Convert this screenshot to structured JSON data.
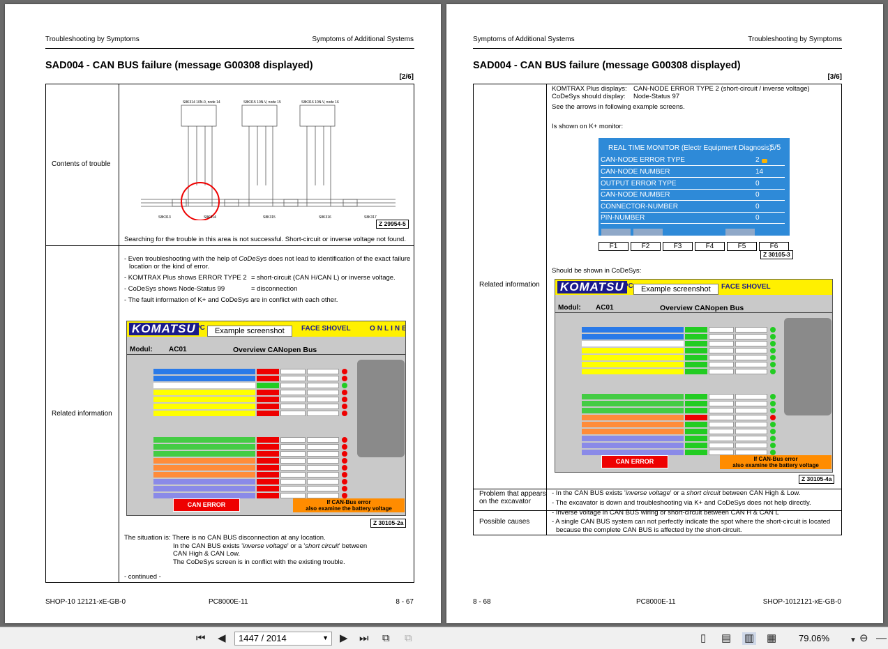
{
  "left_page": {
    "header_left": "Troubleshooting by Symptoms",
    "header_right": "Symptoms of Additional Systems",
    "title": "SAD004 - CAN BUS failure (message G00308 displayed)",
    "page_marker": "[2/6]",
    "contents_label": "Contents of trouble",
    "related_label": "Related information",
    "diagram": {
      "node_labels": [
        "S8K314 10N-0, node 14",
        "S8K315 10N-V, node 15",
        "S8K316 10N-V, node 16"
      ],
      "bottom_labels": [
        "S8K313",
        "S8K314",
        "S8K315",
        "S8K316",
        "S8K317"
      ],
      "zref": "Z 29954-5"
    },
    "search_text": "Searching for the trouble in this area is not successful. Short-circuit or inverse voltage not found.",
    "bullet_1a": "- Even troubleshooting with the help of ",
    "bullet_1_em": "CoDeSys",
    "bullet_1b": " does not lead to identification of the exact failure",
    "bullet_1c": "location or the kind of error.",
    "bullet_2a": "- KOMTRAX Plus shows ERROR TYPE 2",
    "bullet_2b": "= short-circuit (CAN H/CAN L) or inverse voltage.",
    "bullet_3a": "- CoDeSys shows Node-Status 99",
    "bullet_3b": "= disconnection",
    "bullet_4": "- The fault information of K+ and CoDeSys are in conflict with each other.",
    "screenshot": {
      "logo": "KOMATSU",
      "pc": "PC",
      "callout": "Example screenshot",
      "face": "FACE SHOVEL",
      "online": "ONLINE",
      "modul": "Modul:",
      "modul_val": "AC01",
      "overview": "Overview CANopen Bus",
      "can_error": "CAN ERROR",
      "can_bus_1": "If CAN-Bus error",
      "can_bus_2": "also examine the battery voltage",
      "zref": "Z 30105-2a"
    },
    "situation_a": "The situation is: There is no CAN BUS disconnection at any location.",
    "situation_b1": "In the CAN BUS exists '",
    "situation_b_em1": "inverse voltage",
    "situation_b2": "' or a '",
    "situation_b_em2": "short circuit",
    "situation_b3": "' between",
    "situation_c": "CAN High & CAN Low.",
    "situation_d": "The CoDeSys screen is in conflict with the existing trouble.",
    "continued": "- continued -",
    "footer_left": "SHOP-10 12121-xE-GB-0",
    "footer_mid": "PC8000E-11",
    "footer_right": "8  - 67"
  },
  "right_page": {
    "header_left": "Symptoms of Additional Systems",
    "header_right": "Troubleshooting by Symptoms",
    "title": "SAD004 - CAN BUS failure (message G00308 displayed)",
    "page_marker": "[3/6]",
    "related_label": "Related information",
    "komtrax_a": "KOMTRAX Plus displays:",
    "komtrax_b": "CAN-NODE ERROR TYPE 2 (short-circuit / inverse voltage)",
    "codesys_a": "CoDeSys should display:",
    "codesys_b": "Node-Status 97",
    "see_arrows": "See the arrows in following example screens.",
    "shown_kplus": "Is shown on K+ monitor:",
    "monitor": {
      "title": "REAL TIME MONITOR (Electr Equipment Diagnosis)",
      "page": "5/5",
      "rows": [
        {
          "k": "CAN-NODE ERROR TYPE",
          "v": "2"
        },
        {
          "k": "CAN-NODE NUMBER",
          "v": "14"
        },
        {
          "k": "OUTPUT ERROR TYPE",
          "v": "0"
        },
        {
          "k": "CAN-NODE NUMBER",
          "v": "0"
        },
        {
          "k": "CONNECTOR-NUMBER",
          "v": "0"
        },
        {
          "k": "PIN-NUMBER",
          "v": "0"
        }
      ],
      "fkeys": [
        "F1",
        "F2",
        "F3",
        "F4",
        "F5",
        "F6"
      ],
      "zref": "Z 30105-3"
    },
    "shown_codesys": "Should be shown in CoDeSys:",
    "screenshot": {
      "logo": "KOMATSU",
      "pc": "PC",
      "callout": "Example screenshot",
      "face": "FACE SHOVEL",
      "modul": "Modul:",
      "modul_val": "AC01",
      "overview": "Overview CANopen Bus",
      "can_error": "CAN ERROR",
      "can_bus_1": "If CAN-Bus error",
      "can_bus_2": "also examine the battery voltage",
      "zref": "Z 30105-4a"
    },
    "problem_label_1": "Problem that appears",
    "problem_label_2": "on the excavator",
    "problem_1a": "- In the CAN BUS exists '",
    "problem_1_em1": "inverse voltage",
    "problem_1b": "' or a ",
    "problem_1_em2": "short circuit",
    "problem_1c": " between CAN High & Low.",
    "problem_2": "- The excavator is down and troubleshooting via K+ and CoDeSys does not help directly.",
    "causes_label": "Possible causes",
    "cause_1": "- Inverse voltage in CAN BUS wiring or short-circuit between CAN H & CAN L",
    "cause_2a": "- A single CAN BUS system can not perfectly indicate the spot where the short-circuit is located",
    "cause_2b": "because the complete CAN BUS is affected by the short-circuit.",
    "footer_left": "8  - 68",
    "footer_mid": "PC8000E-11",
    "footer_right": "SHOP-1012121-xE-GB-0"
  },
  "toolbar": {
    "page_value": "1447 / 2014",
    "zoom": "79.06%"
  }
}
